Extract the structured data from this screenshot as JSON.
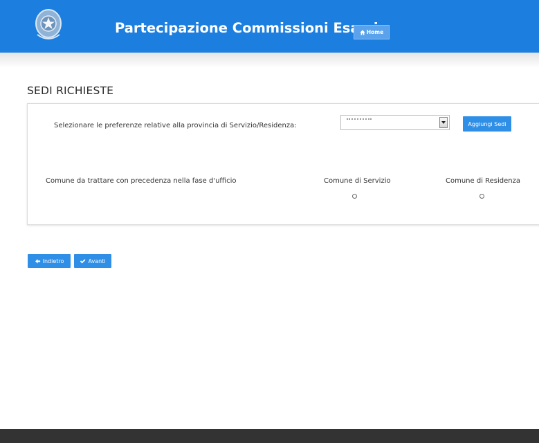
{
  "header": {
    "title": "Partecipazione Commissioni Esami",
    "home_label": "Home",
    "color": "#1c7fe0"
  },
  "section": {
    "title": "SEDI RICHIESTE"
  },
  "preferences": {
    "label": "Selezionare le preferenze relative alla provincia di Servizio/Residenza:",
    "select_value": "",
    "add_button_label": "Aggiungi Sedi"
  },
  "priority": {
    "label": "Comune da trattare con precedenza nella fase d'ufficio",
    "options": [
      {
        "label": "Comune di Servizio",
        "checked": false
      },
      {
        "label": "Comune di Residenza",
        "checked": false
      }
    ]
  },
  "navigation": {
    "back_label": "Indietro",
    "next_label": "Avanti",
    "button_color": "#2f8fe6"
  },
  "icons": {
    "home": "home-icon",
    "back": "arrow-left-icon",
    "next": "check-icon",
    "emblem": "italian-republic-emblem"
  }
}
